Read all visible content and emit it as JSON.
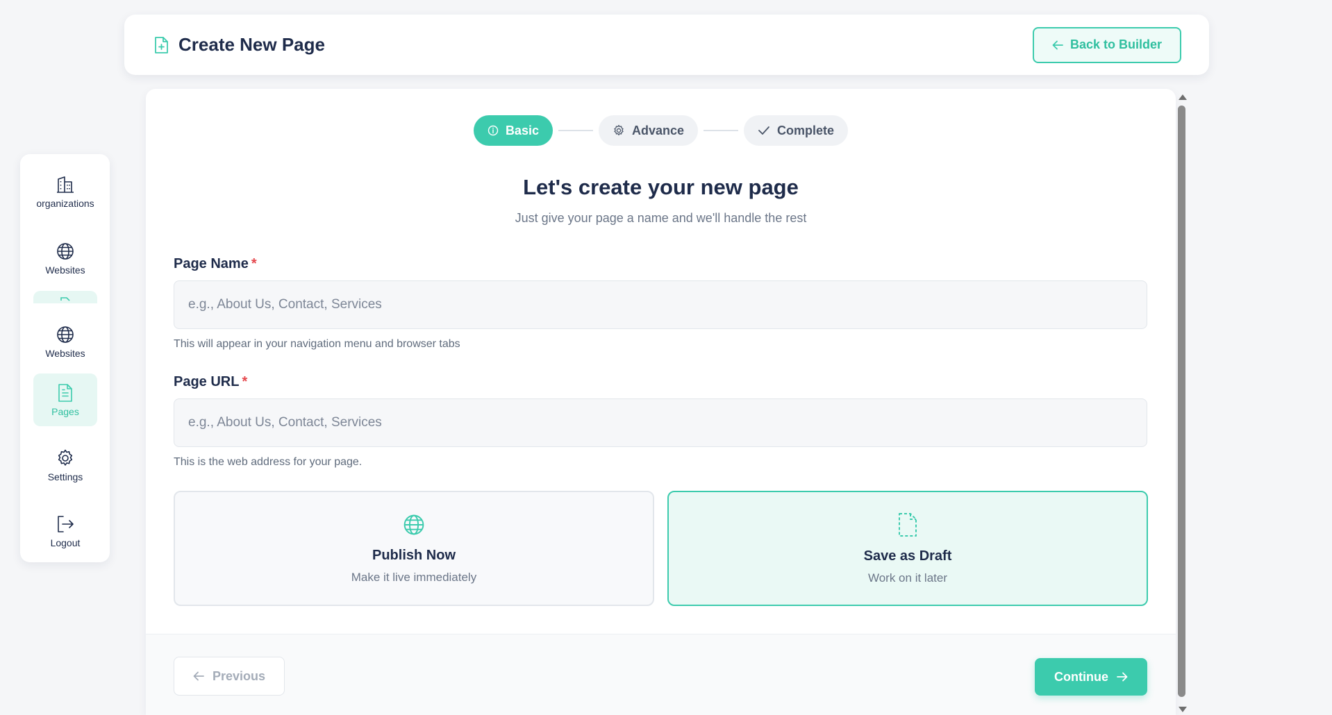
{
  "header": {
    "title": "Create New Page",
    "back_button": "Back to Builder"
  },
  "sidebar": {
    "items": [
      {
        "label": "organizations",
        "icon": "building-icon"
      },
      {
        "label": "Websites",
        "icon": "globe-icon"
      },
      {
        "label": "Websites",
        "icon": "globe-icon"
      },
      {
        "label": "Pages",
        "icon": "file-text-icon",
        "active": true
      },
      {
        "label": "Settings",
        "icon": "gear-icon"
      },
      {
        "label": "Logout",
        "icon": "logout-icon"
      }
    ]
  },
  "stepper": {
    "steps": [
      {
        "label": "Basic",
        "icon": "info-icon",
        "active": true
      },
      {
        "label": "Advance",
        "icon": "gear-icon"
      },
      {
        "label": "Complete",
        "icon": "check-icon"
      }
    ]
  },
  "form": {
    "heading": "Let's create your new page",
    "subheading": "Just give your page a name and we'll handle the rest",
    "page_name": {
      "label": "Page Name",
      "required_mark": "*",
      "placeholder": "e.g., About Us, Contact, Services",
      "value": "",
      "help": "This will appear in your navigation menu and browser tabs"
    },
    "page_url": {
      "label": "Page URL",
      "required_mark": "*",
      "placeholder": "e.g., About Us, Contact, Services",
      "value": "",
      "help": "This is the web address for your page."
    },
    "options": [
      {
        "title": "Publish Now",
        "subtitle": "Make it live immediately",
        "icon": "globe-icon",
        "selected": false
      },
      {
        "title": "Save as Draft",
        "subtitle": "Work on it later",
        "icon": "dashed-file-icon",
        "selected": true
      }
    ]
  },
  "footer": {
    "previous": "Previous",
    "continue": "Continue"
  },
  "colors": {
    "accent": "#3ccbad",
    "text_dark": "#1e2b4a",
    "background": "#f5f6f8"
  }
}
